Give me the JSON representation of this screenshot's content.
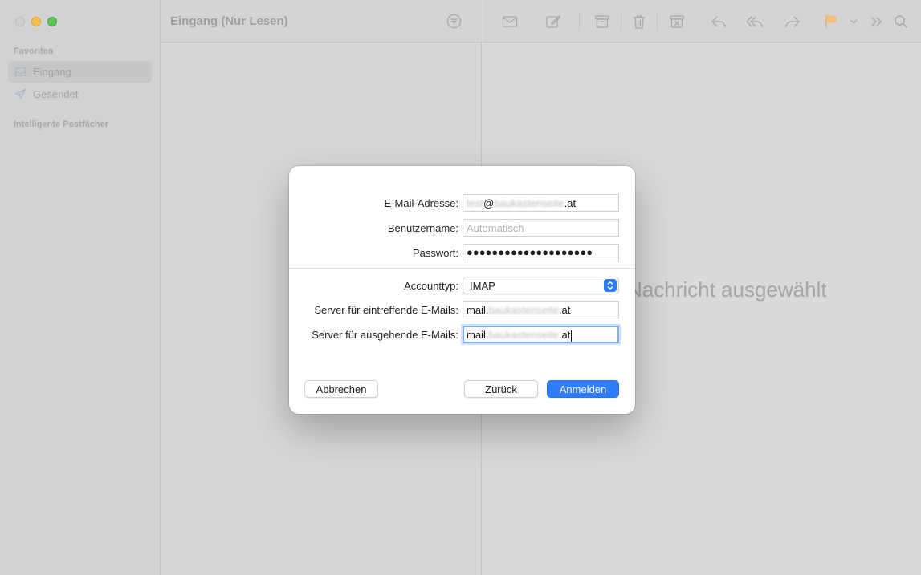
{
  "sidebar": {
    "favorites_heading": "Favoriten",
    "items": [
      {
        "label": "Eingang",
        "icon": "inbox-icon"
      },
      {
        "label": "Gesendet",
        "icon": "paper-plane-icon"
      }
    ],
    "smart_heading": "Intelligente Postfächer"
  },
  "list": {
    "title": "Eingang (Nur Lesen)"
  },
  "message": {
    "empty_text": "Nachricht ausgewählt"
  },
  "dialog": {
    "email_label": "E-Mail-Adresse:",
    "email_value_user": "test",
    "email_value_at": "@",
    "email_value_domain": "baukastenseite",
    "email_value_tld": ".at",
    "username_label": "Benutzername:",
    "username_placeholder": "Automatisch",
    "password_label": "Passwort:",
    "password_value": "●●●●●●●●●●●●●●●●●●●●",
    "account_type_label": "Accounttyp:",
    "account_type_value": "IMAP",
    "incoming_label": "Server für eintreffende E-Mails:",
    "incoming_prefix": "mail.",
    "incoming_domain": "baukastenseite",
    "incoming_tld": ".at",
    "outgoing_label": "Server für ausgehende E-Mails:",
    "outgoing_prefix": "mail.",
    "outgoing_domain": "baukastenseite",
    "outgoing_tld": ".at",
    "cancel_label": "Abbrechen",
    "back_label": "Zurück",
    "signin_label": "Anmelden"
  },
  "colors": {
    "accent": "#2f7cf6",
    "focus_ring": "#7eadf0",
    "flag": "#f4c178"
  }
}
